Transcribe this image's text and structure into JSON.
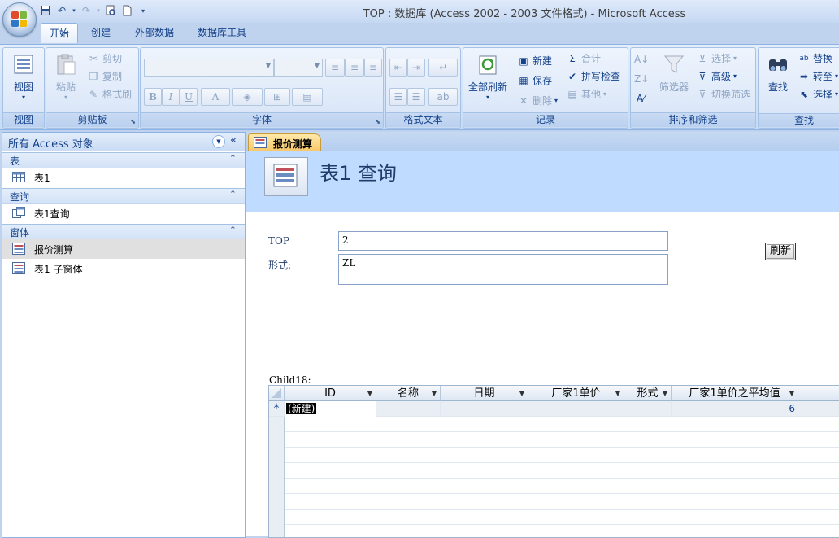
{
  "window": {
    "title": "TOP : 数据库 (Access 2002 - 2003 文件格式) - Microsoft Access"
  },
  "colors": {
    "accent": "#15428b",
    "ribbon": "#dbe7f8",
    "form_header": "#bfdbff",
    "doc_tab": "#f8c768"
  },
  "tabs": [
    "开始",
    "创建",
    "外部数据",
    "数据库工具"
  ],
  "ribbon": {
    "view_label": "视图",
    "view_group": "视图",
    "paste_label": "粘贴",
    "cut_label": "剪切",
    "copy_label": "复制",
    "format_painter_label": "格式刷",
    "clipboard_group": "剪贴板",
    "font_group": "字体",
    "bold": "B",
    "italic": "I",
    "underline": "U",
    "font_color": "A",
    "rich_text_group": "格式文本",
    "refresh_all_label": "全部刷新",
    "new_label": "新建",
    "save_label": "保存",
    "delete_label": "删除",
    "totals_label": "合计",
    "spelling_label": "拼写检查",
    "more_label": "其他",
    "records_group": "记录",
    "filter_label": "筛选器",
    "selection_label": "选择",
    "advanced_label": "高级",
    "toggle_filter_label": "切换筛选",
    "sort_filter_group": "排序和筛选",
    "find_label": "查找",
    "replace_label": "替换",
    "goto_label": "转至",
    "select_label": "选择",
    "find_group": "查找"
  },
  "nav": {
    "title": "所有 Access 对象",
    "sections": [
      {
        "label": "表",
        "items": [
          "表1"
        ]
      },
      {
        "label": "查询",
        "items": [
          "表1查询"
        ]
      },
      {
        "label": "窗体",
        "items": [
          "报价测算",
          "表1 子窗体"
        ]
      }
    ]
  },
  "document": {
    "tab_label": "报价测算",
    "form_title": "表1 查询",
    "top_label": "TOP",
    "top_value": "2",
    "form_label": "形式:",
    "form_value": "ZL",
    "refresh_label": "刷新",
    "child_label": "Child18:",
    "columns": [
      "ID",
      "名称",
      "日期",
      "厂家1单价",
      "形式",
      "厂家1单价之平均值"
    ],
    "new_row_marker": "*",
    "new_row_id": "(新建)",
    "new_row_avg": "6"
  }
}
